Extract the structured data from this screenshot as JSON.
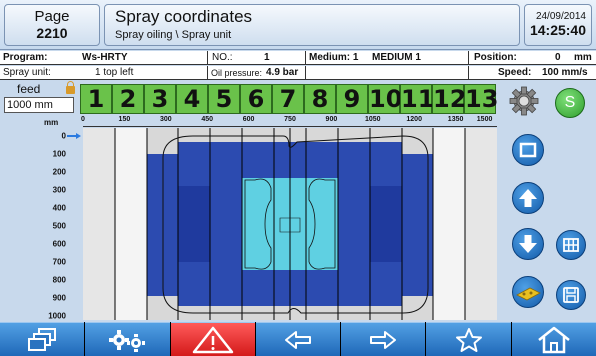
{
  "header": {
    "page_label": "Page",
    "page_number": "2210",
    "title": "Spray coordinates",
    "breadcrumb": "Spray oiling \\ Spray unit",
    "date": "24/09/2014",
    "time": "14:25:40"
  },
  "info_row1": {
    "program_label": "Program:",
    "program_value": "Ws-HRTY",
    "no_label": "NO.:",
    "no_value": "1",
    "medium_label": "Medium: 1",
    "medium_value": "MEDIUM 1",
    "position_label": "Position:",
    "position_value": "0",
    "position_unit": "mm"
  },
  "info_row2": {
    "spray_unit_label": "Spray unit:",
    "spray_unit_value": "1  top left",
    "oil_pressure_label": "Oil pressure:",
    "oil_pressure_value": "4.9 bar",
    "speed_label": "Speed:",
    "speed_value": "100 mm/s"
  },
  "feed": {
    "label": "feed",
    "value": "1000 mm",
    "unit_label": "mm"
  },
  "nozzles": [
    "1",
    "2",
    "3",
    "4",
    "5",
    "6",
    "7",
    "8",
    "9",
    "10",
    "11",
    "12",
    "13"
  ],
  "x_scale": [
    "0",
    "150",
    "300",
    "450",
    "600",
    "750",
    "900",
    "1050",
    "1200",
    "1350",
    "1500"
  ],
  "y_scale": [
    "0",
    "100",
    "200",
    "300",
    "400",
    "500",
    "600",
    "700",
    "800",
    "900",
    "1000"
  ],
  "buttons": {
    "settings_icon": "gear-icon",
    "s_label": "S"
  },
  "colors": {
    "nozzle_green": "#6ac24a",
    "spray_dark": "#2c4bb0",
    "spray_mid": "#1f3a9e",
    "spray_cyan": "#5fd0e2",
    "button_blue": "#1f68b8",
    "warning_red": "#d31a1a",
    "s_button_green": "#4cc24a"
  }
}
